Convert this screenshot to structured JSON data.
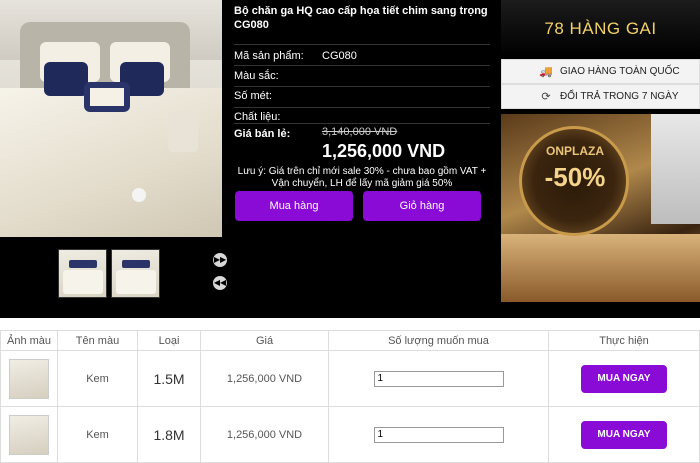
{
  "product": {
    "title": "Bộ chăn ga HQ cao cấp họa tiết chim sang trọng CG080",
    "fields": [
      {
        "label": "Mã sản phẩm:",
        "value": "CG080"
      },
      {
        "label": "Màu sắc:",
        "value": ""
      },
      {
        "label": "Số mét:",
        "value": ""
      },
      {
        "label": "Chất liệu:",
        "value": ""
      }
    ],
    "price_label": "Giá bán lẻ:",
    "old_price": "3,140,000 VND",
    "new_price": "1,256,000 VND",
    "note": "Lưu ý: Giá trên chỉ mới sale 30% - chưa bao gồm VAT + Vận chuyển, LH để lấy mã giảm giá 50%",
    "buy_label": "Mua hàng",
    "cart_label": "Giỏ hàng"
  },
  "sidebar": {
    "brand": "78 HÀNG GAI",
    "services": [
      {
        "icon": "truck-icon",
        "label": "GIAO HÀNG TOÀN QUỐC"
      },
      {
        "icon": "return-icon",
        "label": "ĐỔI TRẢ TRONG 7 NGÀY"
      }
    ],
    "promo_brand": "ONPLAZA",
    "promo_discount": "-50%"
  },
  "table": {
    "headers": [
      "Ảnh màu",
      "Tên màu",
      "Loại",
      "Giá",
      "Số lượng muốn mua",
      "Thực hiện"
    ],
    "rows": [
      {
        "color": "Kem",
        "type": "1.5M",
        "price": "1,256,000 VND",
        "qty": "1",
        "action": "MUA NGAY"
      },
      {
        "color": "Kem",
        "type": "1.8M",
        "price": "1,256,000 VND",
        "qty": "1",
        "action": "MUA NGAY"
      }
    ]
  },
  "colors": {
    "accent": "#8a0ad6",
    "brand_gold": "#f2d06b"
  }
}
